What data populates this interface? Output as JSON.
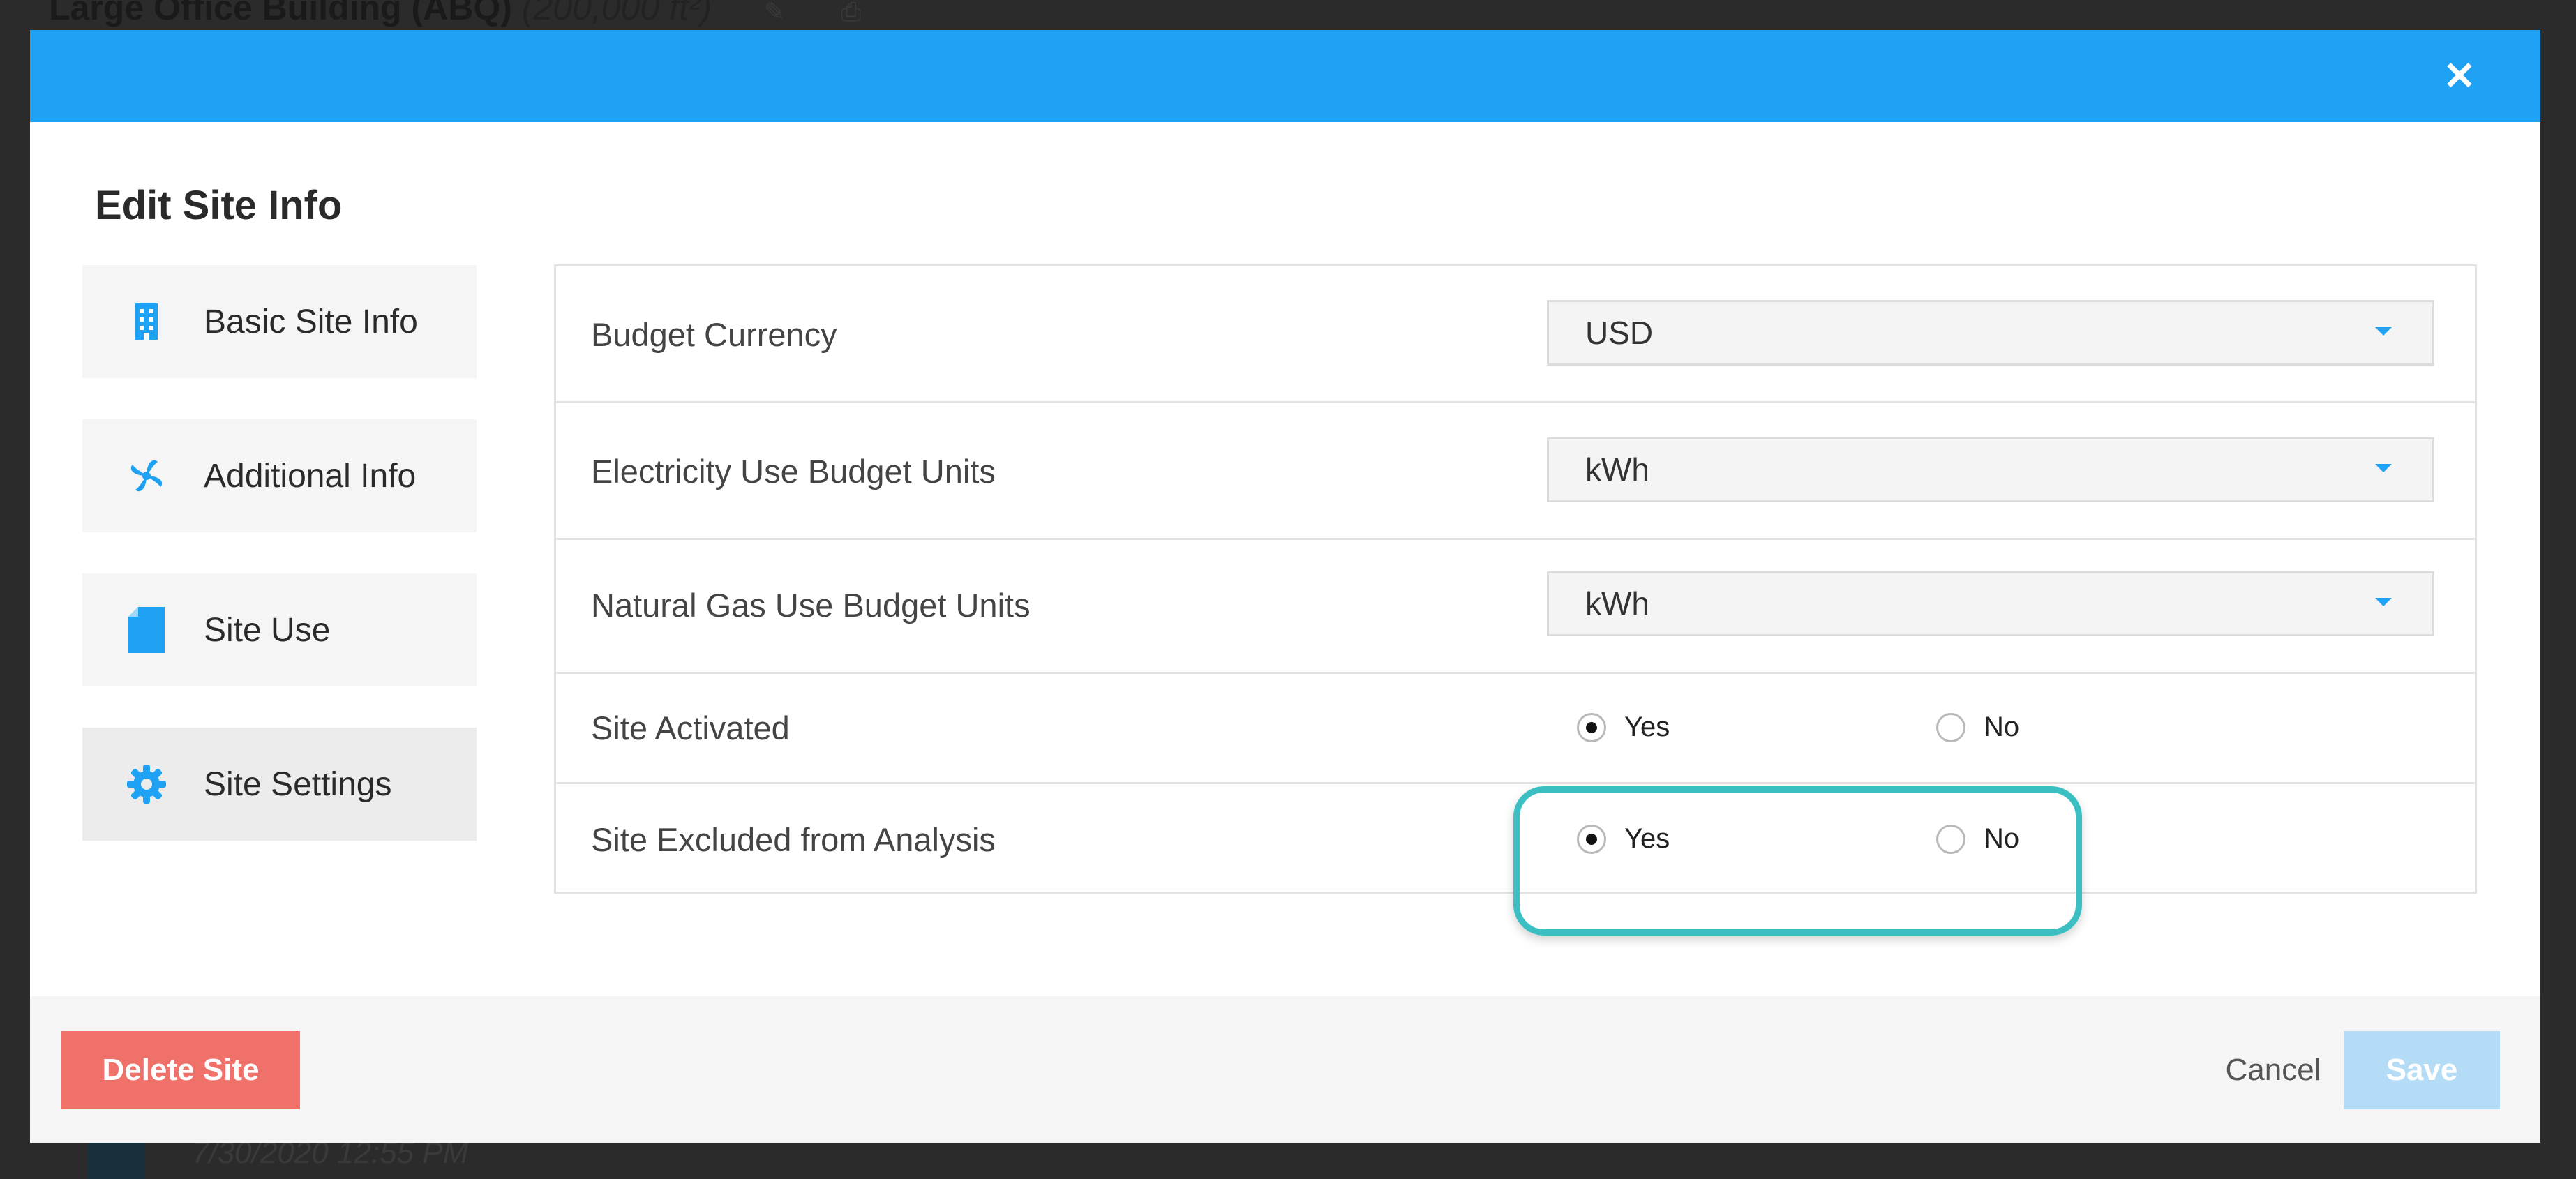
{
  "background": {
    "title": "Large Office Building (ABQ)",
    "area": "(200,000 ft²)",
    "timestamp": "7/30/2020 12:55 PM"
  },
  "modal": {
    "close_icon": "close-icon",
    "title": "Edit Site Info"
  },
  "sidebar": {
    "items": [
      {
        "label": "Basic Site Info",
        "icon": "building-icon"
      },
      {
        "label": "Additional Info",
        "icon": "fan-icon"
      },
      {
        "label": "Site Use",
        "icon": "document-icon"
      },
      {
        "label": "Site Settings",
        "icon": "gear-icon",
        "active": true
      }
    ]
  },
  "settings": {
    "budget_currency": {
      "label": "Budget Currency",
      "value": "USD"
    },
    "electricity_units": {
      "label": "Electricity Use Budget Units",
      "value": "kWh"
    },
    "gas_units": {
      "label": "Natural Gas Use Budget Units",
      "value": "kWh"
    },
    "site_activated": {
      "label": "Site Activated",
      "yes": "Yes",
      "no": "No",
      "selected": "Yes"
    },
    "site_excluded": {
      "label": "Site Excluded from Analysis",
      "yes": "Yes",
      "no": "No",
      "selected": "Yes"
    }
  },
  "footer": {
    "delete_label": "Delete Site",
    "cancel_label": "Cancel",
    "save_label": "Save"
  },
  "colors": {
    "header": "#1fa2f3",
    "delete": "#ef7169",
    "save_disabled": "#b4dcf6",
    "highlight": "#3bbfc2"
  }
}
